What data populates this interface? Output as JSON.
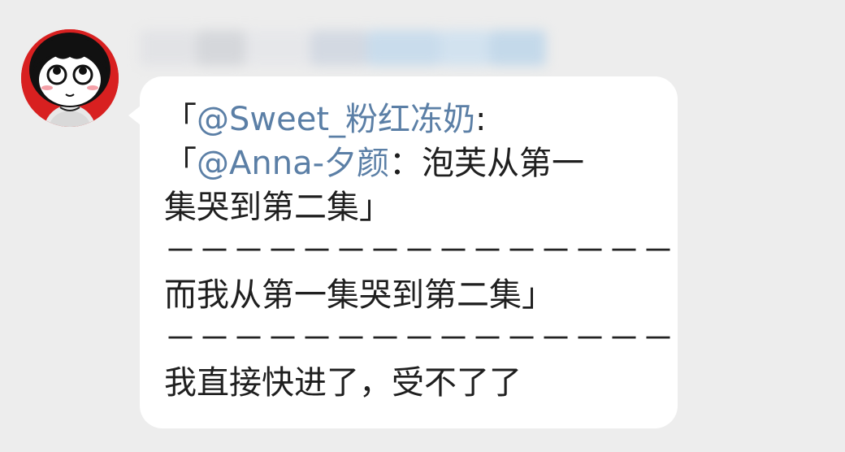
{
  "colors": {
    "background": "#ededed",
    "bubble": "#ffffff",
    "text": "#1f1f1f",
    "mention": "#5b7fa6",
    "avatar_red": "#d82020"
  },
  "avatar": {
    "icon": "cartoon-girl-avatar"
  },
  "message": {
    "line1": {
      "open": "「",
      "mention": "@Sweet_粉红冻奶",
      "after": ":"
    },
    "line2": {
      "open": "「",
      "mention": "@Anna-夕颜",
      "after": "：泡芙从第一"
    },
    "line3": "集哭到第二集」",
    "divider": "－－－－－－－－－－－－－－－",
    "line5": "而我从第一集哭到第二集」",
    "line7": "我直接快进了，受不了了"
  }
}
